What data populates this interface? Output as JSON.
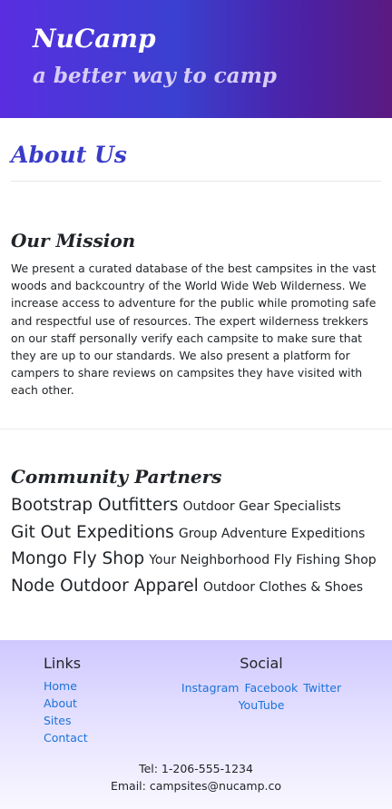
{
  "header": {
    "brand": "NuCamp",
    "tagline": "a better way to camp",
    "gradient_colors": [
      "#5a2ee0",
      "#3a40d0",
      "#5a1a80"
    ]
  },
  "about": {
    "title": "About Us"
  },
  "mission": {
    "title": "Our Mission",
    "text": "We present a curated database of the best campsites in the vast woods and backcountry of the World Wide Web Wilderness. We increase access to adventure for the public while promoting safe and respectful use of resources. The expert wilderness trekkers on our staff personally verify each campsite to make sure that they are up to our standards. We also present a platform for campers to share reviews on campsites they have visited with each other."
  },
  "partners": {
    "title": "Community Partners",
    "items": [
      {
        "name": "Bootstrap Outfitters",
        "desc": "Outdoor Gear Specialists"
      },
      {
        "name": "Git Out Expeditions",
        "desc": "Group Adventure Expeditions"
      },
      {
        "name": "Mongo Fly Shop",
        "desc": "Your Neighborhood Fly Fishing Shop"
      },
      {
        "name": "Node Outdoor Apparel",
        "desc": "Outdoor Clothes & Shoes"
      }
    ]
  },
  "footer": {
    "links_title": "Links",
    "links": [
      "Home",
      "About",
      "Sites",
      "Contact"
    ],
    "social_title": "Social",
    "social": [
      "Instagram",
      "Facebook",
      "Twitter",
      "YouTube"
    ],
    "tel": "Tel: 1-206-555-1234",
    "email": "Email: campsites@nucamp.co",
    "link_color": "#1a73d9"
  }
}
